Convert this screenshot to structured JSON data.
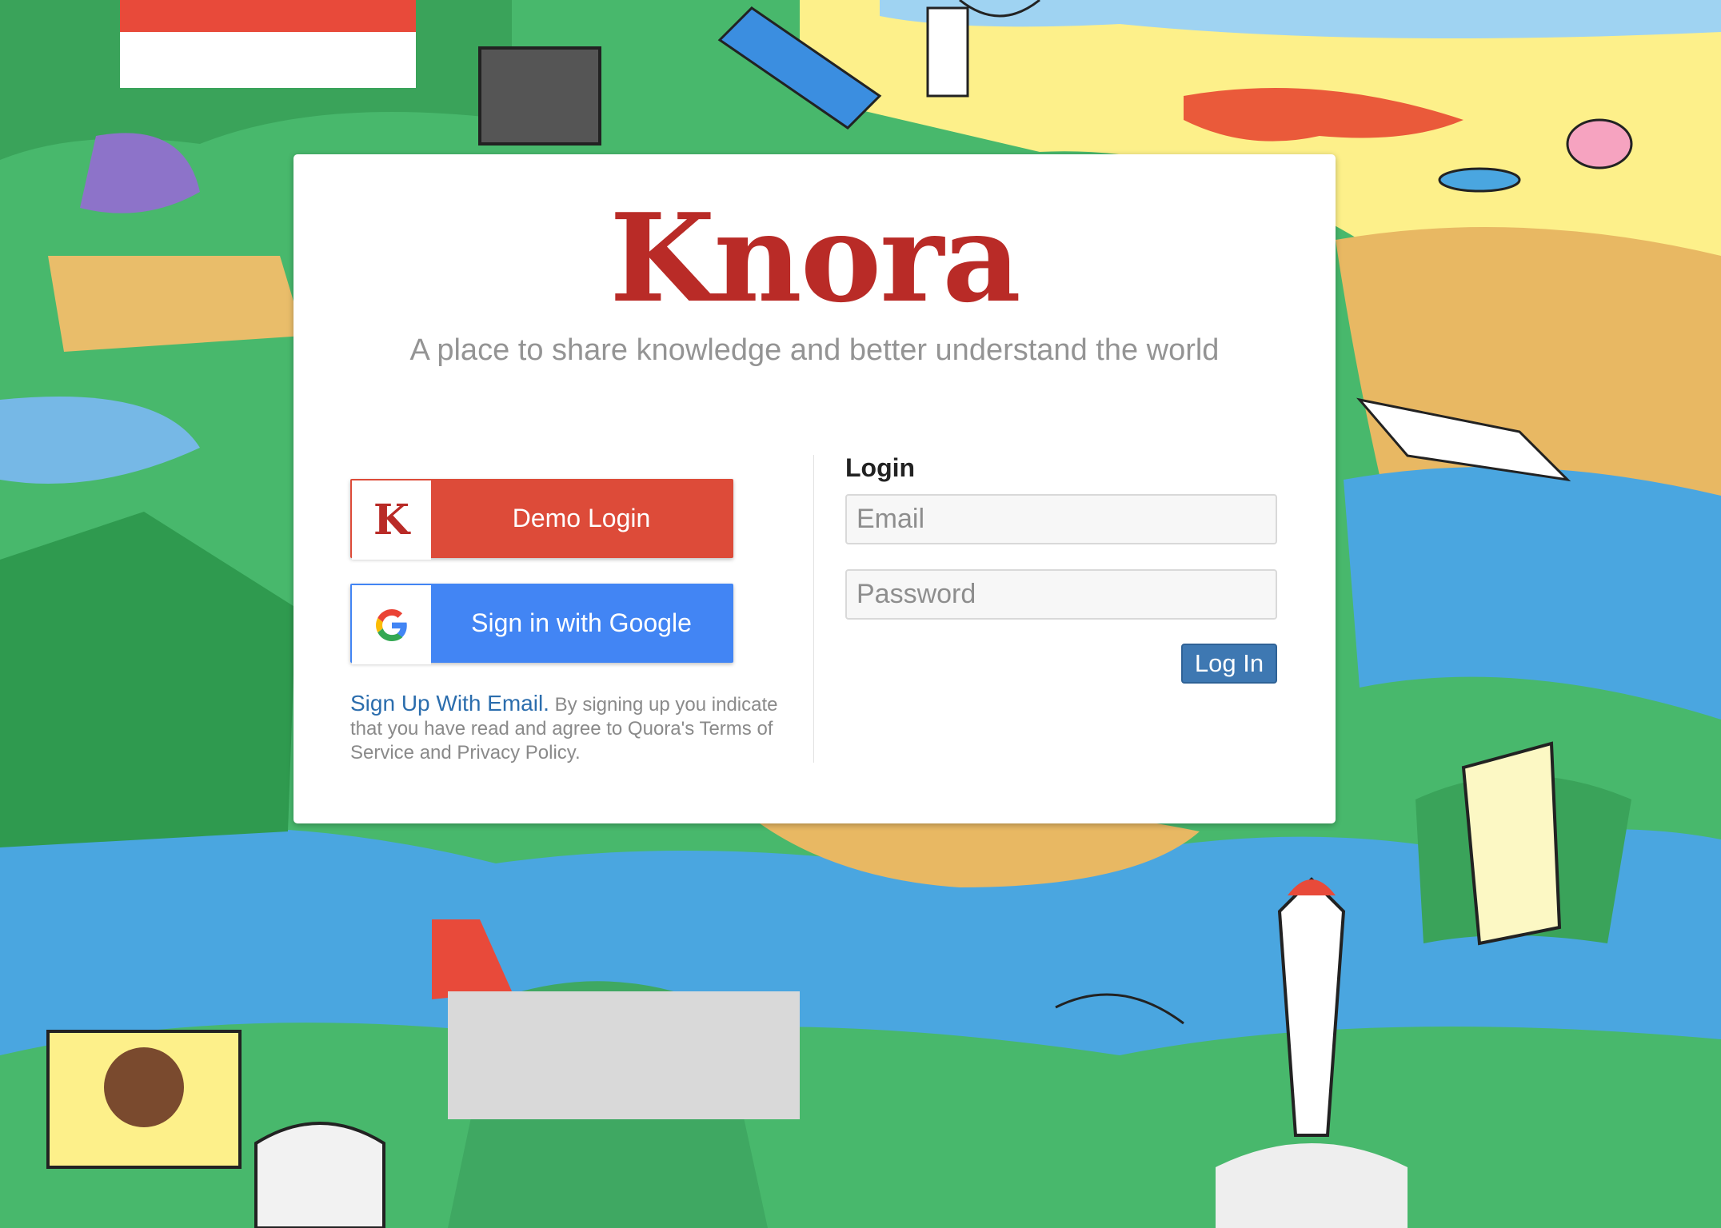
{
  "colors": {
    "brand": "#b92b27",
    "demo_button": "#dd4b39",
    "google_button": "#4285f4",
    "login_button": "#3e78b2",
    "link": "#2b6dad"
  },
  "card": {
    "logo": "Knora",
    "tagline": "A place to share knowledge and better understand the world"
  },
  "social": {
    "demo": {
      "icon": "knora-k-icon",
      "glyph": "K",
      "label": "Demo Login"
    },
    "google": {
      "icon": "google-icon",
      "label": "Sign in with Google"
    }
  },
  "terms": {
    "signup_link": "Sign Up With Email.",
    "text": "By signing up you indicate that you have read and agree to Quora's Terms of Service and Privacy Policy."
  },
  "login": {
    "title": "Login",
    "email_placeholder": "Email",
    "password_placeholder": "Password",
    "submit_label": "Log In"
  }
}
